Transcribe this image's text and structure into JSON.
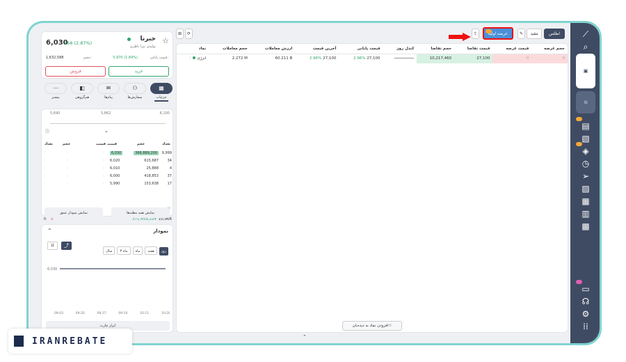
{
  "stock": {
    "name": "خبرنا",
    "company": "تولیدی نیرا ناظری",
    "price": "6,030",
    "change": "168 (2.87%)",
    "final_label": "قیمت پایانی:",
    "final_value": "5,970 (1.84%)",
    "volume_label": "حجم:",
    "volume_value": "1,632,588"
  },
  "actions": {
    "buy": "خرید",
    "sell": "فروش"
  },
  "left_tabs": [
    {
      "label": "جزئیات"
    },
    {
      "label": "سفارش‌ها"
    },
    {
      "label": "پیام‌ها"
    },
    {
      "label": "هم‌گروهی"
    },
    {
      "label": "بیشتر"
    }
  ],
  "range": {
    "left": "5,690",
    "mid": "5,862",
    "right": "6,100"
  },
  "orderbook": {
    "headers": {
      "count": "تعداد",
      "volume": "حجم",
      "price": "قیمت"
    },
    "bids": [
      {
        "count": "9,999",
        "volume": "366,889,200",
        "price": "6,030"
      },
      {
        "count": "34",
        "volume": "615,687",
        "price": "6,020"
      },
      {
        "count": "4",
        "volume": "25,888",
        "price": "6,010"
      },
      {
        "count": "37",
        "volume": "418,853",
        "price": "6,000"
      },
      {
        "count": "17",
        "volume": "153,638",
        "price": "5,990"
      }
    ],
    "total_label": "کل",
    "total_count": "10,966",
    "total_volume": "371,459,224",
    "ask_total_a": "0",
    "ask_total_b": "0",
    "btn_all": "نمایش همه مظنه‌ها",
    "btn_depth": "نمایش نمودار عمق"
  },
  "chart": {
    "title": "نمودار",
    "ranges": [
      "روز",
      "هفته",
      "ماه",
      "۳ ماه",
      "سال"
    ],
    "analysis": "ابزار چارت"
  },
  "chart_data": {
    "type": "line",
    "x": [
      "09:03",
      "09:20",
      "09:37",
      "09:54",
      "10:11",
      "10:28"
    ],
    "values": [
      6030,
      6030,
      6030,
      6030,
      6030,
      6030
    ],
    "y_tick": "6,030"
  },
  "toolbar": {
    "atlas": "اطلس",
    "filter": "مقید",
    "initial_offer": "عرضه اولیه",
    "offer_badge": "1"
  },
  "table": {
    "headers": [
      "نماد",
      "حجم معاملات",
      "ارزش معاملات",
      "آخرین قیمت",
      "قیمت پایانی",
      "کندل روز",
      "حجم تقاضا",
      "قیمت تقاضا",
      "قیمت عرضه",
      "حجم عرضه"
    ],
    "row": {
      "symbol": "انرژی",
      "volume": "2.272 M",
      "value": "60.211 B",
      "last": "27,100",
      "last_pct": "2.96%",
      "final": "27,100",
      "final_pct": "2.96%",
      "bid_vol": "10,217,460",
      "bid_price": "27,100",
      "ask_price": "0",
      "ask_vol": "0"
    }
  },
  "add_watch": "افزودن نماد به دیده‌بان",
  "watermark": "IRANREBATE",
  "colors": {
    "accent": "#2fa56e",
    "danger": "#e0515b",
    "sidebar": "#3f4b63",
    "highlight": "#4a90d9"
  }
}
